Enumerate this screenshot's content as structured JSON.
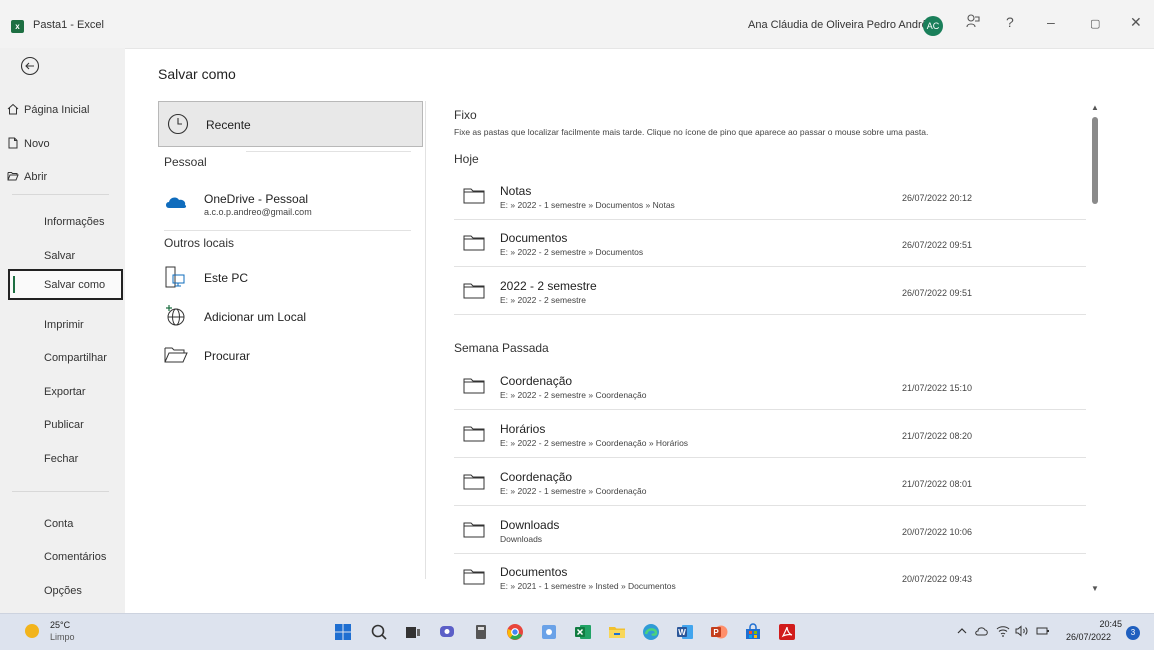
{
  "titlebar": {
    "logo": "x",
    "title": "Pasta1 - Excel",
    "user_name": "Ana Cláudia de Oliveira Pedro Andrêo",
    "avatar_initials": "AC",
    "help": "?",
    "minimize": "–",
    "restore": "▢",
    "close": "✕"
  },
  "sidebar": {
    "top": [
      {
        "label": "Página Inicial",
        "icon": "home-icon"
      },
      {
        "label": "Novo",
        "icon": "new-document-icon"
      },
      {
        "label": "Abrir",
        "icon": "open-folder-icon"
      }
    ],
    "middle": [
      "Informações",
      "Salvar",
      "Salvar como",
      "Imprimir",
      "Compartilhar",
      "Exportar",
      "Publicar",
      "Fechar"
    ],
    "active": "Salvar como",
    "bottom": [
      "Conta",
      "Comentários",
      "Opções"
    ]
  },
  "page_title": "Salvar como",
  "locations": {
    "recent": "Recente",
    "personal_header": "Pessoal",
    "onedrive_name": "OneDrive - Pessoal",
    "onedrive_email": "a.c.o.p.andreo@gmail.com",
    "other_header": "Outros locais",
    "este_pc": "Este PC",
    "add_location": "Adicionar um Local",
    "browse": "Procurar"
  },
  "pinned": {
    "header": "Fixo",
    "description": "Fixe as pastas que localizar facilmente mais tarde. Clique no ícone de pino que aparece ao passar o mouse sobre uma pasta."
  },
  "today": {
    "header": "Hoje",
    "folders": [
      {
        "name": "Notas",
        "path": "E: » 2022 - 1 semestre » Documentos » Notas",
        "date": "26/07/2022 20:12"
      },
      {
        "name": "Documentos",
        "path": "E: » 2022 - 2 semestre » Documentos",
        "date": "26/07/2022 09:51"
      },
      {
        "name": "2022 - 2 semestre",
        "path": "E: » 2022 - 2 semestre",
        "date": "26/07/2022 09:51"
      }
    ]
  },
  "last_week": {
    "header": "Semana Passada",
    "folders": [
      {
        "name": "Coordenação",
        "path": "E: » 2022 - 2 semestre » Coordenação",
        "date": "21/07/2022 15:10"
      },
      {
        "name": "Horários",
        "path": "E: » 2022 - 2 semestre » Coordenação » Horários",
        "date": "21/07/2022 08:20"
      },
      {
        "name": "Coordenação",
        "path": "E: » 2022 - 1 semestre » Coordenação",
        "date": "21/07/2022 08:01"
      },
      {
        "name": "Downloads",
        "path": "Downloads",
        "date": "20/07/2022 10:06"
      },
      {
        "name": "Documentos",
        "path": "E: » 2021 - 1 semestre » Insted » Documentos",
        "date": "20/07/2022 09:43"
      }
    ]
  },
  "scroll": {
    "up": "▲",
    "down": "▼"
  },
  "taskbar": {
    "weather_temp": "25°C",
    "weather_cond": "Limpo",
    "time": "20:45",
    "date": "26/07/2022",
    "notifications": "3",
    "apps": [
      {
        "icon": "windows-start-icon",
        "color": "#1f6fd1"
      },
      {
        "icon": "search-icon",
        "color": "#333333"
      },
      {
        "icon": "task-view-icon",
        "color": "#333333"
      },
      {
        "icon": "chat-icon",
        "color": "#5b5fc7"
      },
      {
        "icon": "calculator-icon",
        "color": "#555555"
      },
      {
        "icon": "chrome-icon",
        "color": "#e8453c"
      },
      {
        "icon": "app-icon",
        "color": "#6aa2e8"
      },
      {
        "icon": "excel-icon",
        "color": "#1d6f42"
      },
      {
        "icon": "file-explorer-icon",
        "color": "#f2c12e"
      },
      {
        "icon": "edge-icon",
        "color": "#2f9bd6"
      },
      {
        "icon": "word-icon",
        "color": "#2b579a"
      },
      {
        "icon": "powerpoint-icon",
        "color": "#d24726"
      },
      {
        "icon": "store-icon",
        "color": "#1f6fd1"
      },
      {
        "icon": "acrobat-icon",
        "color": "#d11c1c"
      }
    ]
  }
}
